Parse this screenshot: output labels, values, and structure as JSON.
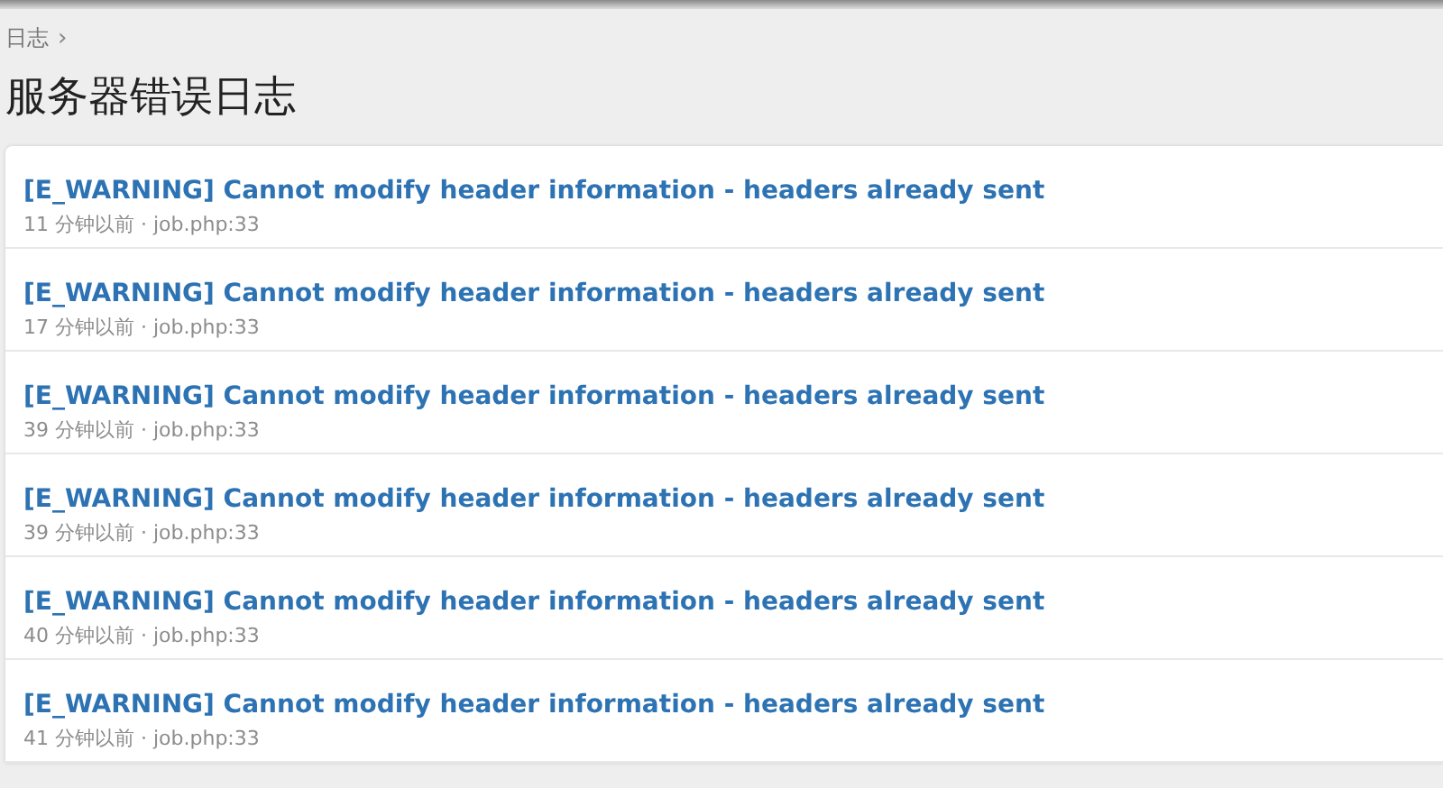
{
  "breadcrumb": {
    "label": "日志",
    "separator": "›"
  },
  "title": "服务器错误日志",
  "entries": [
    {
      "message": "[E_WARNING] Cannot modify header information - headers already sent",
      "meta": "11 分钟以前 · job.php:33"
    },
    {
      "message": "[E_WARNING] Cannot modify header information - headers already sent",
      "meta": "17 分钟以前 · job.php:33"
    },
    {
      "message": "[E_WARNING] Cannot modify header information - headers already sent",
      "meta": "39 分钟以前 · job.php:33"
    },
    {
      "message": "[E_WARNING] Cannot modify header information - headers already sent",
      "meta": "39 分钟以前 · job.php:33"
    },
    {
      "message": "[E_WARNING] Cannot modify header information - headers already sent",
      "meta": "40 分钟以前 · job.php:33"
    },
    {
      "message": "[E_WARNING] Cannot modify header information - headers already sent",
      "meta": "41 分钟以前 · job.php:33"
    }
  ]
}
